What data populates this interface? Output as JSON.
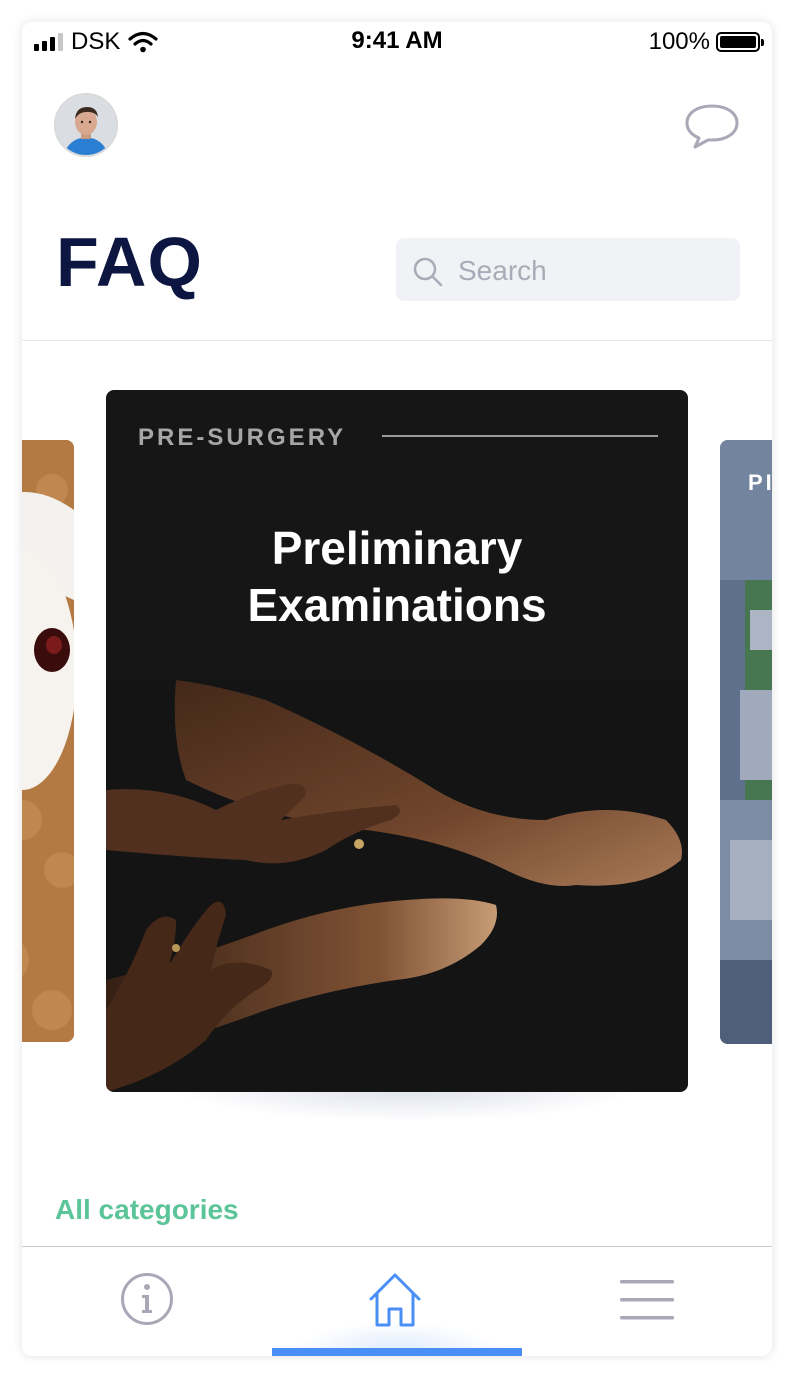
{
  "status_bar": {
    "carrier": "DSK",
    "time": "9:41 AM",
    "battery": "100%",
    "icons": [
      "signal-icon",
      "wifi-icon",
      "battery-icon"
    ]
  },
  "header": {
    "avatar_icon": "user-avatar",
    "chat_icon": "chat-bubble-icon"
  },
  "page": {
    "title": "FAQ"
  },
  "search": {
    "placeholder": "Search",
    "value": "",
    "icon": "search-icon"
  },
  "carousel": {
    "cards": [
      {
        "position": "left",
        "image": "teddy-bear-photo"
      },
      {
        "position": "center",
        "category": "PRE-SURGERY",
        "title_line1": "Preliminary",
        "title_line2": "Examinations",
        "image": "hands-and-feet-photo"
      },
      {
        "position": "right",
        "category_visible": "PI",
        "image": "operating-room-photo"
      }
    ]
  },
  "links": {
    "all_categories": "All categories"
  },
  "tab_bar": {
    "tabs": [
      {
        "name": "info",
        "icon": "info-icon",
        "active": false
      },
      {
        "name": "home",
        "icon": "home-icon",
        "active": true
      },
      {
        "name": "menu",
        "icon": "menu-icon",
        "active": false
      }
    ]
  },
  "colors": {
    "title": "#0d1640",
    "accent_green": "#5bc599",
    "active_tab": "#4a8ff5",
    "inactive_icon": "#a8a8b6",
    "card_bg": "#161616"
  }
}
